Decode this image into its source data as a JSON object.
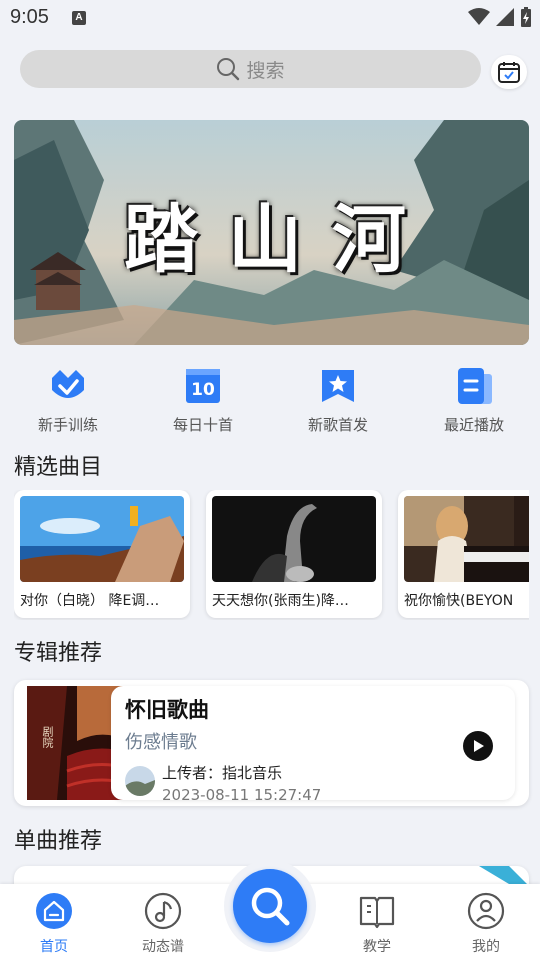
{
  "status_bar": {
    "time": "9:05",
    "notification_letter": "A"
  },
  "search": {
    "placeholder": "搜索"
  },
  "banner": {
    "title": "踏山河"
  },
  "quick_nav": [
    {
      "label": "新手训练",
      "icon": "badge-check-icon"
    },
    {
      "label": "每日十首",
      "icon": "calendar-10-icon",
      "badge": "10"
    },
    {
      "label": "新歌首发",
      "icon": "star-bookmark-icon"
    },
    {
      "label": "最近播放",
      "icon": "document-list-icon"
    }
  ],
  "featured": {
    "title": "精选曲目",
    "items": [
      {
        "label": "对你（白晓） 降E调…",
        "image": "ukulele-sea"
      },
      {
        "label": "天天想你(张雨生)降…",
        "image": "saxophone-dark"
      },
      {
        "label": "祝你愉快(BEYON",
        "image": "piano-girl"
      }
    ]
  },
  "album": {
    "section_title": "专辑推荐",
    "title": "怀旧歌曲",
    "subtitle": "伤感情歌",
    "uploader": "上传者：指北音乐",
    "date": "2023-08-11 15:27:47",
    "cover_text": "剧院"
  },
  "single": {
    "section_title": "单曲推荐"
  },
  "bottom_nav": [
    {
      "label": "首页",
      "icon": "home-icon",
      "active": true
    },
    {
      "label": "动态谱",
      "icon": "music-note-disc-icon",
      "active": false
    },
    {
      "label": "教学",
      "icon": "book-icon",
      "active": false
    },
    {
      "label": "我的",
      "icon": "profile-icon",
      "active": false
    }
  ],
  "colors": {
    "accent": "#2e7cf6",
    "background": "#f0f2f7",
    "subtitle": "#6d7d90"
  }
}
